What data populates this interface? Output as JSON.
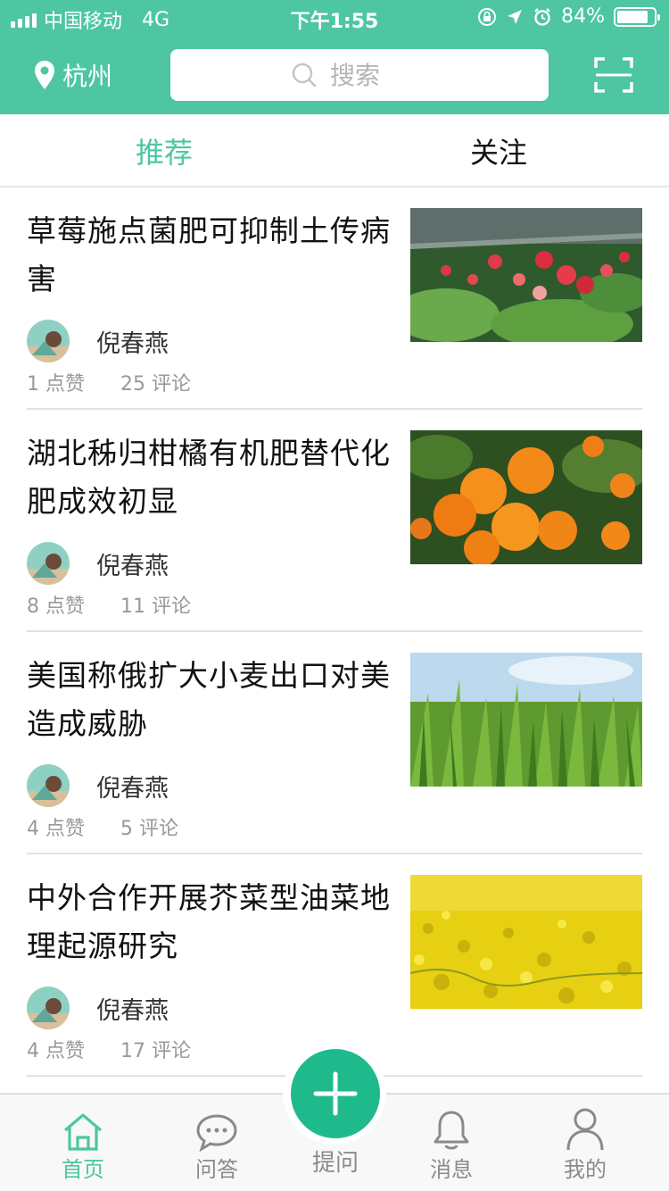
{
  "status_bar": {
    "carrier": "中国移动",
    "network": "4G",
    "time": "下午1:55",
    "battery": "84%",
    "battery_level": 0.84
  },
  "header": {
    "city": "杭州",
    "search_placeholder": "搜索",
    "icons": {
      "location": "location-pin-icon",
      "search": "search-icon",
      "scan": "scan-icon"
    }
  },
  "tabs": [
    {
      "label": "推荐",
      "active": true
    },
    {
      "label": "关注",
      "active": false
    }
  ],
  "feed": [
    {
      "title": "草莓施点菌肥可抑制土传病害",
      "author": "倪春燕",
      "likes": "1 点赞",
      "comments": "25 评论",
      "image": "strawberry-photo"
    },
    {
      "title": "湖北秭归柑橘有机肥替代化肥成效初显",
      "author": "倪春燕",
      "likes": "8 点赞",
      "comments": "11 评论",
      "image": "citrus-photo"
    },
    {
      "title": "美国称俄扩大小麦出口对美造成威胁",
      "author": "倪春燕",
      "likes": "4 点赞",
      "comments": "5 评论",
      "image": "wheat-photo"
    },
    {
      "title": "中外合作开展芥菜型油菜地理起源研究",
      "author": "倪春燕",
      "likes": "4 点赞",
      "comments": "17 评论",
      "image": "rapeseed-photo"
    }
  ],
  "tabbar": {
    "items": [
      {
        "label": "首页",
        "icon": "home-icon",
        "active": true
      },
      {
        "label": "问答",
        "icon": "chat-icon",
        "active": false
      },
      {
        "label": "提问",
        "icon": "plus-icon",
        "active": false
      },
      {
        "label": "消息",
        "icon": "bell-icon",
        "active": false
      },
      {
        "label": "我的",
        "icon": "user-icon",
        "active": false
      }
    ]
  },
  "colors": {
    "brand": "#4dc6a1",
    "fab": "#1fba8c"
  }
}
